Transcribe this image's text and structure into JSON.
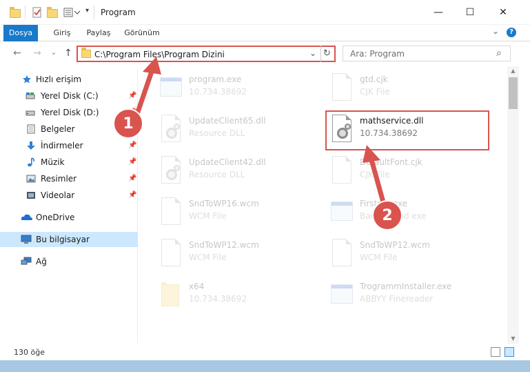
{
  "window": {
    "title": "Program",
    "minimize_glyph": "—",
    "maximize_glyph": "☐",
    "close_glyph": "✕"
  },
  "ribbon": {
    "tabs": [
      {
        "label": "Dosya",
        "active": true
      },
      {
        "label": "Giriş",
        "active": false
      },
      {
        "label": "Paylaş",
        "active": false
      },
      {
        "label": "Görünüm",
        "active": false
      }
    ],
    "expand_glyph": "⌄",
    "help_glyph": "?"
  },
  "navigation": {
    "back_glyph": "←",
    "forward_glyph": "→",
    "recent_glyph": "⌄",
    "up_glyph": "↑",
    "address_path": "C:\\Program Files\\Program Dizini",
    "address_dropdown_glyph": "⌄",
    "refresh_glyph": "↻",
    "search_placeholder": "Ara: Program",
    "search_glyph": "⌕"
  },
  "sidebar": {
    "items": [
      {
        "label": "Hızlı erişim",
        "icon": "star-icon",
        "pinned": false
      },
      {
        "label": "Yerel Disk (C:)",
        "icon": "drive-icon",
        "pinned": true
      },
      {
        "label": "Yerel Disk (D:)",
        "icon": "drive-icon",
        "pinned": true
      },
      {
        "label": "Belgeler",
        "icon": "documents-icon",
        "pinned": true
      },
      {
        "label": "İndirmeler",
        "icon": "downloads-icon",
        "pinned": true
      },
      {
        "label": "Müzik",
        "icon": "music-icon",
        "pinned": true
      },
      {
        "label": "Resimler",
        "icon": "pictures-icon",
        "pinned": true
      },
      {
        "label": "Videolar",
        "icon": "videos-icon",
        "pinned": true
      },
      {
        "label": "OneDrive",
        "icon": "cloud-icon",
        "pinned": false
      },
      {
        "label": "Bu bilgisayar",
        "icon": "computer-icon",
        "pinned": false,
        "selected": true
      },
      {
        "label": "Ağ",
        "icon": "network-icon",
        "pinned": false
      }
    ],
    "pin_glyph": "📌"
  },
  "files": [
    {
      "name": "program.exe",
      "sub": "10.734.38692",
      "type": "exe",
      "faded": true
    },
    {
      "name": "gtd.cjk",
      "sub": "CJK File",
      "type": "doc",
      "faded": true
    },
    {
      "name": "UpdateClient65.dll",
      "sub": "Resource DLL",
      "type": "dll",
      "faded": true
    },
    {
      "name": "mathservice.dll",
      "sub": "10.734.38692",
      "type": "dll",
      "faded": false
    },
    {
      "name": "UpdateClient42.dll",
      "sub": "Resource DLL",
      "type": "dll",
      "faded": true
    },
    {
      "name": "DefaultFont.cjk",
      "sub": "CJK File",
      "type": "doc",
      "faded": true
    },
    {
      "name": "SndToWP16.wcm",
      "sub": "WCM File",
      "type": "doc",
      "faded": true
    },
    {
      "name": "Firstrec.exe",
      "sub": "Background exe",
      "type": "app",
      "faded": true
    },
    {
      "name": "SndToWP12.wcm",
      "sub": "WCM File",
      "type": "doc",
      "faded": true
    },
    {
      "name": "SndToWP12.wcm",
      "sub": "WCM File",
      "type": "doc",
      "faded": true
    },
    {
      "name": "x64",
      "sub": "10.734.38692",
      "type": "folder",
      "faded": true
    },
    {
      "name": "TrogrammInstaller.exe",
      "sub": "ABBYY Finereader",
      "type": "app",
      "faded": true
    }
  ],
  "status": {
    "item_count": "130 öğe"
  },
  "annotations": {
    "step1": "1",
    "step2": "2"
  },
  "colors": {
    "accent": "#1979ca",
    "highlight": "#d9534f",
    "selected_bg": "#cce8ff"
  }
}
